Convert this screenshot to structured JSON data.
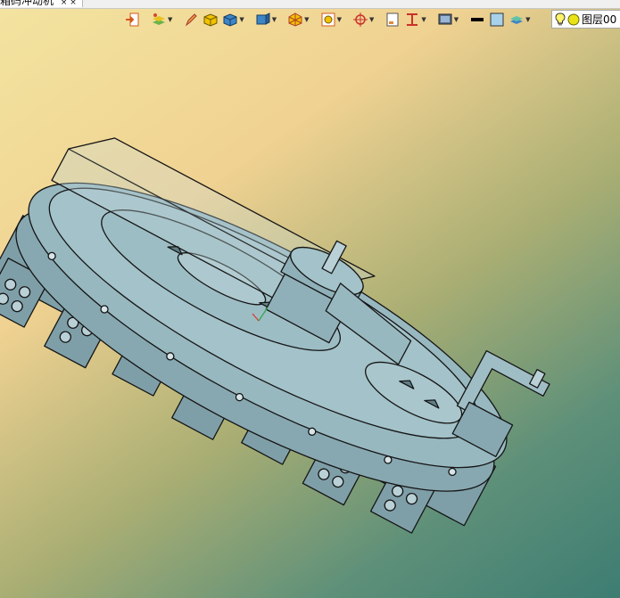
{
  "document_tab": {
    "title": "箱码冲动机",
    "close_glyph": "× ×"
  },
  "toolbar": {
    "buttons": [
      {
        "name": "import-icon",
        "dropdown": false
      },
      {
        "name": "paint-layers-icon",
        "dropdown": true
      },
      {
        "name": "pen-icon",
        "dropdown": false
      },
      {
        "name": "yellow-box-icon",
        "dropdown": false
      },
      {
        "name": "blue-box-icon",
        "dropdown": true
      },
      {
        "name": "view-cube-icon",
        "dropdown": true
      },
      {
        "name": "render-mode-icon",
        "dropdown": true
      },
      {
        "name": "zoom-fit-icon",
        "dropdown": true
      },
      {
        "name": "pivot-icon",
        "dropdown": true
      },
      {
        "name": "page-icon",
        "dropdown": false
      },
      {
        "name": "section-icon",
        "dropdown": true
      },
      {
        "name": "display-icon",
        "dropdown": true
      },
      {
        "name": "line-color-icon",
        "dropdown": false
      },
      {
        "name": "fill-color-icon",
        "dropdown": false
      },
      {
        "name": "layers-icon",
        "dropdown": true
      }
    ]
  },
  "layer_selector": {
    "value": "图层00"
  },
  "colors": {
    "model_fill": "#8fb0b8",
    "model_line": "#1a1a1a",
    "accent_yellow": "#f2c200",
    "accent_blue": "#3d86c6"
  }
}
